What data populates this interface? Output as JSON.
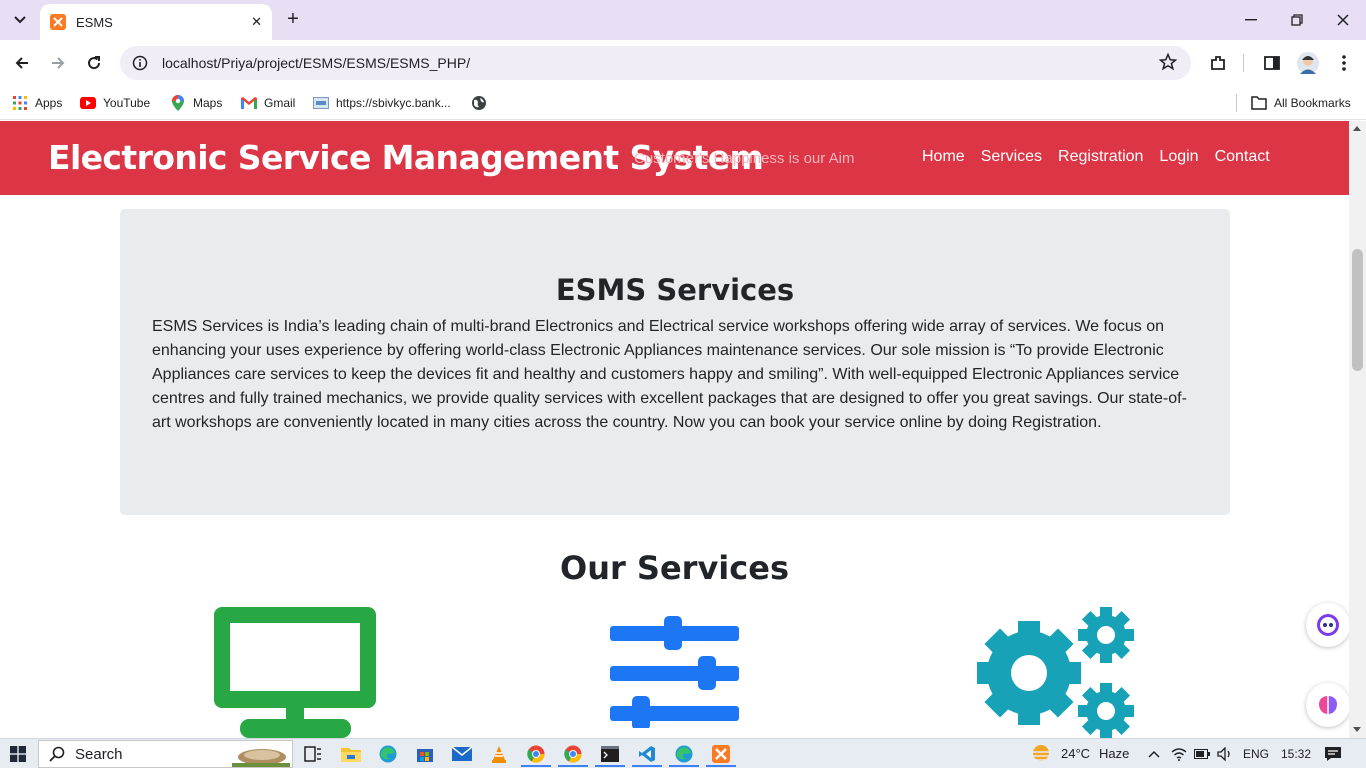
{
  "browser": {
    "tab_title": "ESMS",
    "url": "localhost/Priya/project/ESMS/ESMS/ESMS_PHP/",
    "bookmarks": [
      {
        "label": "Apps",
        "icon": "apps-grid-icon"
      },
      {
        "label": "YouTube",
        "icon": "youtube-icon"
      },
      {
        "label": "Maps",
        "icon": "maps-icon"
      },
      {
        "label": "Gmail",
        "icon": "gmail-icon"
      },
      {
        "label": "https://sbivkyc.bank...",
        "icon": "bank-site-icon"
      }
    ],
    "all_bookmarks": "All Bookmarks"
  },
  "site": {
    "brand": "Electronic Service Management System",
    "tagline": "Customer's Happiness is our Aim",
    "menu": [
      "Home",
      "Services",
      "Registration",
      "Login",
      "Contact"
    ],
    "colors": {
      "navbar": "#dc3545",
      "jumbotron": "#e9ecef",
      "monitor": "#28a745",
      "sliders": "#1d76f3",
      "gears": "#17a2b8"
    }
  },
  "jumbotron": {
    "title": "ESMS Services",
    "text": "ESMS Services is India’s leading chain of multi-brand Electronics and Electrical service workshops offering wide array of services. We focus on enhancing your uses experience by offering world-class Electronic Appliances maintenance services. Our sole mission is “To provide Electronic Appliances care services to keep the devices fit and healthy and customers happy and smiling”. With well-equipped Electronic Appliances service centres and fully trained mechanics, we provide quality services with excellent packages that are designed to offer you great savings. Our state-of-art workshops are conveniently located in many cities across the country. Now you can book your service online by doing Registration."
  },
  "services": {
    "title": "Our Services",
    "icons": [
      "monitor-icon",
      "sliders-icon",
      "gears-icon"
    ]
  },
  "taskbar": {
    "search": "Search",
    "weather": "24°C",
    "weather_desc": "Haze",
    "lang": "ENG",
    "time": "15:32"
  }
}
